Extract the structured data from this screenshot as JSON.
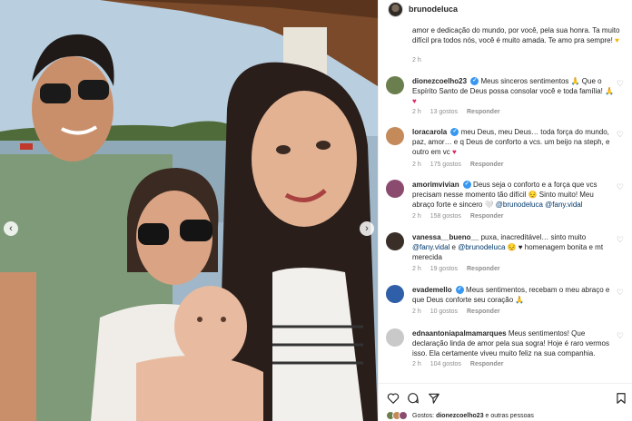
{
  "header": {
    "username": "brunodeluca",
    "verified": true
  },
  "caption": {
    "text": "amor e dedicação do mundo, por você, pela sua honra. Ta muito difícil pra todos nós, você é muito amada. Te amo pra sempre! ",
    "emoji": "♥",
    "time": "2 h"
  },
  "comments": [
    {
      "username": "dionezcoelho23",
      "verified": true,
      "text": " Meus sinceros sentimentos 🙏 Que o Espírito Santo de Deus possa consolar você e toda família! 🙏 ",
      "heart": "♥",
      "time": "2 h",
      "likes": "13 gostos",
      "reply": "Responder",
      "avatar_color": "#6b7f4e"
    },
    {
      "username": "loracarola",
      "verified": true,
      "text": " meu Deus, meu Deus… toda força do mundo, paz, amor… e q Deus de conforto a vcs. um beijo na steph, e outro em vc ",
      "heart": "♥",
      "time": "2 h",
      "likes": "175 gostos",
      "reply": "Responder",
      "avatar_color": "#c58a5a"
    },
    {
      "username": "amorimvivian",
      "verified": true,
      "text": " Deus seja o conforto e a força que vcs precisam nesse momento tão difícil 😔 Sinto muito! Meu abraço forte e sincero 🤍 ",
      "m1": "@brunodeluca",
      "m2": "@fany.vidal",
      "time": "2 h",
      "likes": "158 gostos",
      "reply": "Responder",
      "avatar_color": "#8a4b6e"
    },
    {
      "username": "vanessa__bueno__",
      "verified": false,
      "text": " puxa, inacreditável… sinto muito ",
      "m1": "@fany.vidal",
      "and": " e ",
      "m2": "@brunodeluca",
      "tail": " 😔 ♥ homenagem bonita e mt merecida",
      "time": "2 h",
      "likes": "19 gostos",
      "reply": "Responder",
      "avatar_color": "#3a2e28"
    },
    {
      "username": "evademello",
      "verified": true,
      "text": " Meus sentimentos, recebam o meu abraço e que Deus conforte seu coração 🙏",
      "time": "2 h",
      "likes": "10 gostos",
      "reply": "Responder",
      "avatar_color": "#2f5fa8"
    },
    {
      "username": "ednaantoniapalmamarques",
      "verified": false,
      "text": " Meus sentimentos! Que declaração linda de amor pela sua sogra! Hoje é raro vermos isso. Ela certamente viveu muito feliz na sua companhia.",
      "time": "2 h",
      "likes": "104 gostos",
      "reply": "Responder",
      "avatar_color": "#c9c9c9"
    }
  ],
  "likes_summary": {
    "prefix": "Gostos: ",
    "user": "dionezcoelho23",
    "suffix": " e outras pessoas"
  },
  "colors": {
    "verified": "#3897f0",
    "mention": "#00376b",
    "meta": "#8e8e8e",
    "heart": "#e0245e"
  },
  "icons": [
    "heart-icon",
    "comment-icon",
    "share-icon",
    "bookmark-icon",
    "chevron-left-icon",
    "chevron-right-icon"
  ]
}
